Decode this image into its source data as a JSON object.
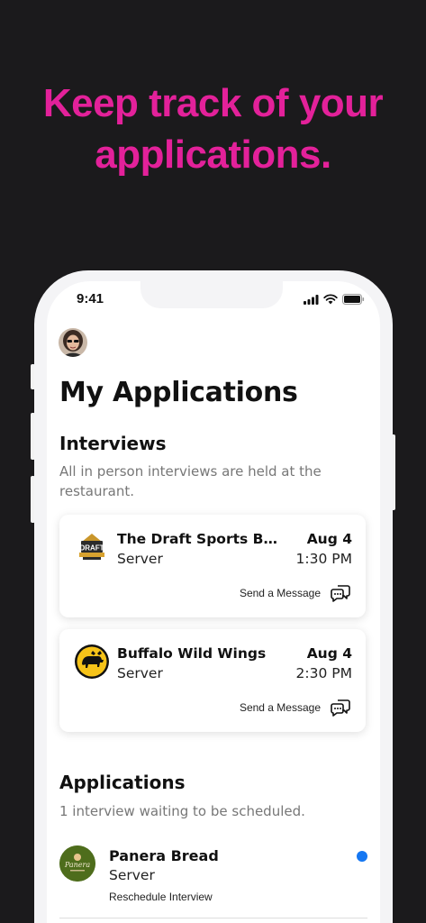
{
  "promo": {
    "headline_line1": "Keep track of your",
    "headline_line2": "applications."
  },
  "status_bar": {
    "time": "9:41"
  },
  "page": {
    "title": "My Applications"
  },
  "interviews": {
    "title": "Interviews",
    "subtitle": "All in person interviews are held at the restaurant.",
    "items": [
      {
        "name": "The Draft Sports Bar...",
        "role": "Server",
        "date": "Aug 4",
        "time": "1:30 PM",
        "action": "Send a Message",
        "logo_text": "DRAFT"
      },
      {
        "name": "Buffalo Wild Wings",
        "role": "Server",
        "date": "Aug 4",
        "time": "2:30 PM",
        "action": "Send a Message"
      }
    ]
  },
  "applications": {
    "title": "Applications",
    "subtitle": "1 interview waiting to be scheduled.",
    "items": [
      {
        "name": "Panera Bread",
        "role": "Server",
        "action": "Reschedule Interview",
        "logo_text": "Panera"
      }
    ]
  },
  "colors": {
    "background": "#1b1a1c",
    "headline": "#e3219a",
    "unread_dot": "#1577f2"
  }
}
